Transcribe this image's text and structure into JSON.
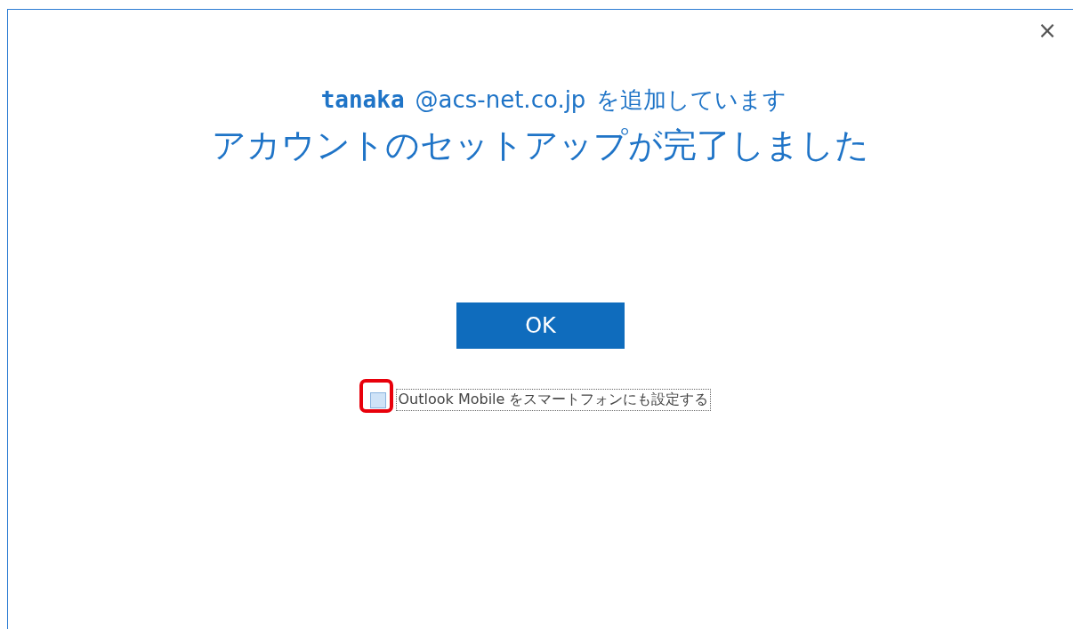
{
  "window": {
    "close_label": "×"
  },
  "adding": {
    "user": "tanaka",
    "domain": "@acs-net.co.jp",
    "suffix": "を追加しています"
  },
  "title": "アカウントのセットアップが完了しました",
  "ok_button": "OK",
  "mobile_option": {
    "label": "Outlook Mobile をスマートフォンにも設定する",
    "checked": false,
    "highlighted": true
  }
}
